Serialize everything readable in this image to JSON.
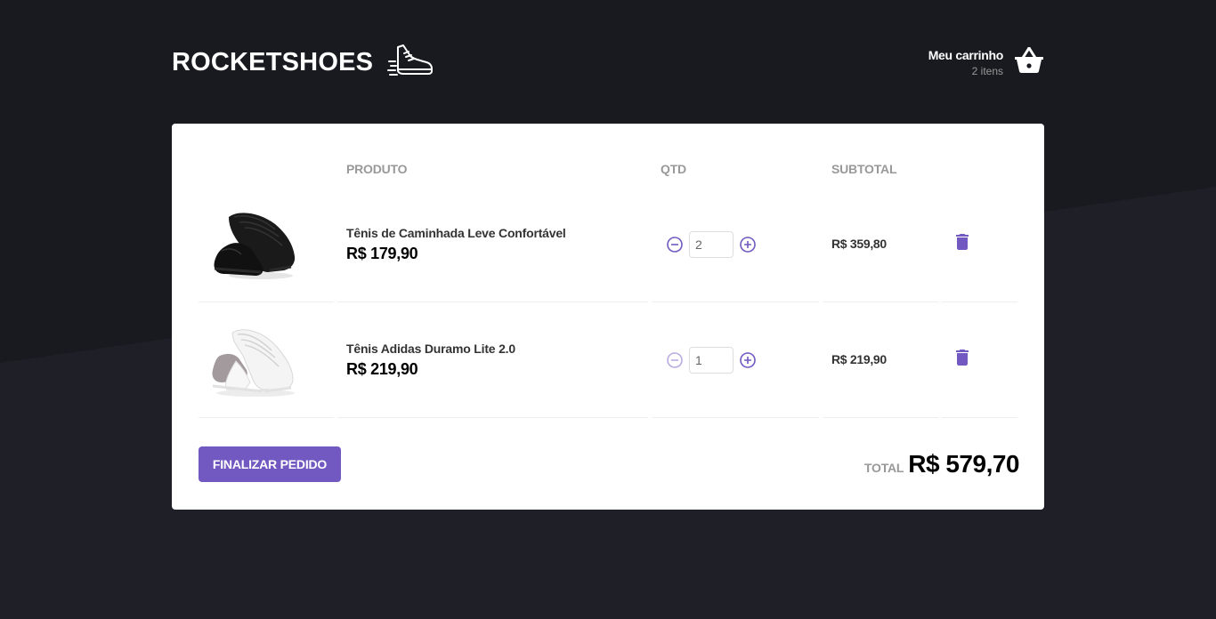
{
  "header": {
    "logo_text": "ROCKETSHOES",
    "logo_icon": "sneaker-icon",
    "cart_title": "Meu carrinho",
    "cart_count": "2 itens",
    "cart_icon": "basket-icon"
  },
  "table": {
    "headers": [
      "",
      "PRODUTO",
      "QTD",
      "SUBTOTAL",
      ""
    ],
    "rows": [
      {
        "image": "black-sneaker",
        "name": "Tênis de Caminhada Leve Confortável",
        "price": "R$ 179,90",
        "quantity": "2",
        "subtotal": "R$ 359,80"
      },
      {
        "image": "white-sneaker",
        "name": "Tênis Adidas Duramo Lite 2.0",
        "price": "R$ 219,90",
        "quantity": "1",
        "subtotal": "R$ 219,90"
      }
    ]
  },
  "footer": {
    "finish_label": "FINALIZAR PEDIDO",
    "total_label": "TOTAL",
    "total_value": "R$ 579,70"
  },
  "colors": {
    "background": "#191920",
    "accent": "#7159c1",
    "card": "#ffffff"
  }
}
